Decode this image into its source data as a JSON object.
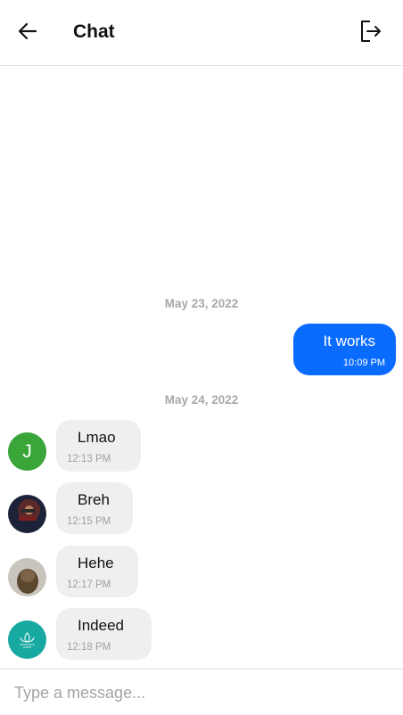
{
  "header": {
    "title": "Chat",
    "back_icon": "arrow-left-icon",
    "logout_icon": "logout-icon"
  },
  "messages": {
    "date_groups": [
      {
        "date": "May 23, 2022"
      },
      {
        "date": "May 24, 2022"
      }
    ],
    "outgoing": [
      {
        "text": "It works",
        "time": "10:09 PM"
      }
    ],
    "incoming": [
      {
        "text": "Lmao",
        "time": "12:13 PM",
        "avatar": "J"
      },
      {
        "text": "Breh",
        "time": "12:15 PM"
      },
      {
        "text": "Hehe",
        "time": "12:17 PM"
      },
      {
        "text": "Indeed",
        "time": "12:18 PM"
      }
    ]
  },
  "composer": {
    "placeholder": "Type a message..."
  },
  "colors": {
    "accent": "#0a6cff",
    "incoming_bubble": "#efefef",
    "avatar_green": "#3aa63a",
    "avatar_teal": "#17a9a1"
  }
}
